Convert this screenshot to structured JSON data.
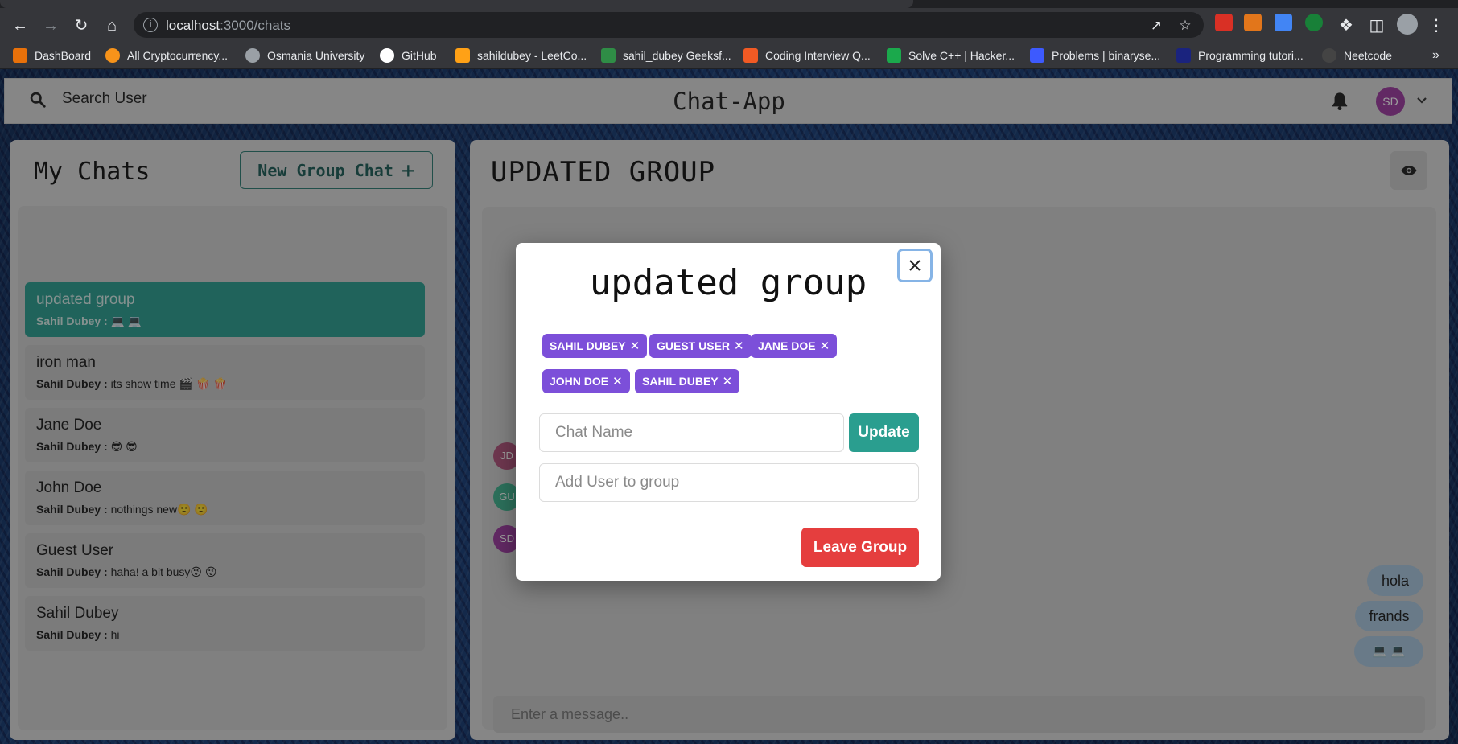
{
  "browser": {
    "url_host": "localhost",
    "url_path": ":3000/chats",
    "bookmarks": [
      {
        "label": "DashBoard",
        "color": "#e8710a"
      },
      {
        "label": "All Cryptocurrency...",
        "color": "#f7931a"
      },
      {
        "label": "Osmania University",
        "color": "#9aa0a6"
      },
      {
        "label": "GitHub",
        "color": "#ffffff"
      },
      {
        "label": "sahildubey - LeetCo...",
        "color": "#ffa116"
      },
      {
        "label": "sahil_dubey Geeksf...",
        "color": "#2f8d46"
      },
      {
        "label": "Coding Interview Q...",
        "color": "#f15a24"
      },
      {
        "label": "Solve C++ | Hacker...",
        "color": "#1ba94c"
      },
      {
        "label": "Problems | binaryse...",
        "color": "#3d5afe"
      },
      {
        "label": "Programming tutori...",
        "color": "#1a237e"
      },
      {
        "label": "Neetcode",
        "color": "#444444"
      }
    ],
    "bookmarks_overflow": "»"
  },
  "header": {
    "search_label": "Search User",
    "brand": "Chat-App",
    "avatar_initials": "SD"
  },
  "sidebar": {
    "title": "My Chats",
    "new_group_label": "New Group Chat",
    "new_group_icon": "+",
    "chats": [
      {
        "name": "updated group",
        "sender": "Sahil Dubey :",
        "message": "💻 💻",
        "active": true
      },
      {
        "name": "iron man",
        "sender": "Sahil Dubey :",
        "message": "its show time 🎬 🍿 🍿",
        "active": false
      },
      {
        "name": "Jane Doe",
        "sender": "Sahil Dubey :",
        "message": "😎 😎",
        "active": false
      },
      {
        "name": "John Doe",
        "sender": "Sahil Dubey :",
        "message": "nothings new🙁 🙁",
        "active": false
      },
      {
        "name": "Guest User",
        "sender": "Sahil Dubey :",
        "message": "haha! a bit busy😜 😜",
        "active": false
      },
      {
        "name": "Sahil Dubey",
        "sender": "Sahil Dubey :",
        "message": "hi",
        "active": false
      }
    ]
  },
  "chat": {
    "title": "UPDATED GROUP",
    "avatars": [
      {
        "initials": "JD",
        "color": "#b0527a"
      },
      {
        "initials": "GU",
        "color": "#3fb38f"
      },
      {
        "initials": "SD",
        "color": "#9b3a9f"
      }
    ],
    "messages": [
      "hola",
      "frands",
      "💻 💻"
    ],
    "input_placeholder": "Enter a message.."
  },
  "modal": {
    "title": "updated group",
    "members": [
      "SAHIL DUBEY",
      "GUEST USER",
      "JANE DOE",
      "JOHN DOE",
      "SAHIL DUBEY"
    ],
    "chat_name_placeholder": "Chat Name",
    "update_label": "Update",
    "add_user_placeholder": "Add User to group",
    "leave_label": "Leave Group"
  },
  "colors": {
    "accent_teal": "#2a9e8f",
    "tag_purple": "#7c4fd9",
    "danger_red": "#e53e3e"
  }
}
